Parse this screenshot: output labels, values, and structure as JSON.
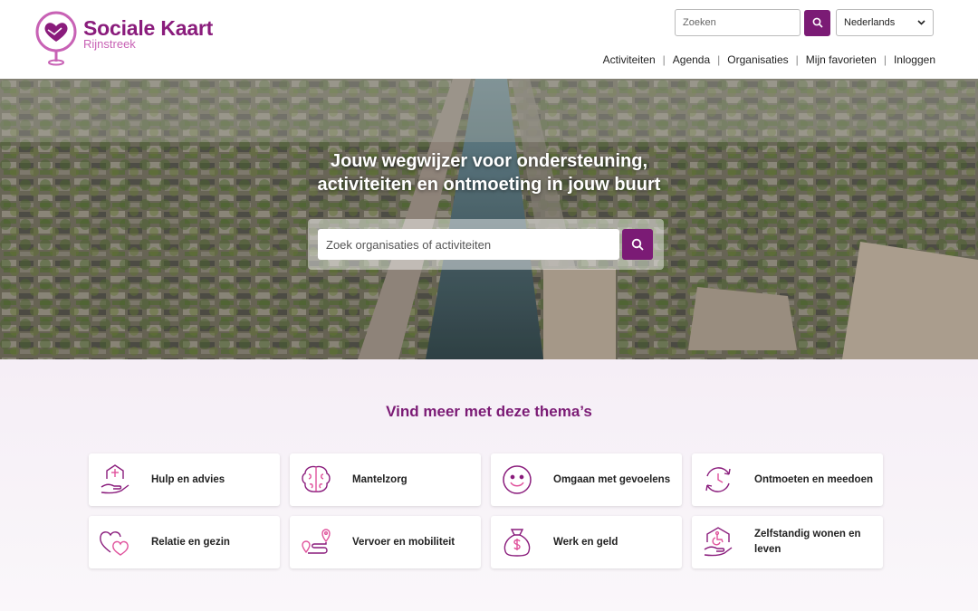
{
  "brand": {
    "title": "Sociale Kaart",
    "subtitle": "Rijnstreek",
    "primary_color": "#7b1b75",
    "accent_color": "#c862b5"
  },
  "header": {
    "search": {
      "placeholder": "Zoeken"
    },
    "language": {
      "selected": "Nederlands"
    },
    "nav": [
      "Activiteiten",
      "Agenda",
      "Organisaties",
      "Mijn favorieten",
      "Inloggen"
    ]
  },
  "hero": {
    "title_line1": "Jouw wegwijzer voor ondersteuning,",
    "title_line2": "activiteiten en ontmoeting in jouw buurt",
    "search_placeholder": "Zoek organisaties of activiteiten"
  },
  "themes": {
    "title": "Vind meer met deze thema’s",
    "items": [
      {
        "label": "Hulp en advies",
        "icon": "hand-house-icon"
      },
      {
        "label": "Mantelzorg",
        "icon": "brain-icon"
      },
      {
        "label": "Omgaan met gevoelens",
        "icon": "smiley-icon"
      },
      {
        "label": "Ontmoeten en meedoen",
        "icon": "clock-cycle-icon"
      },
      {
        "label": "Relatie en gezin",
        "icon": "hearts-icon"
      },
      {
        "label": "Vervoer en mobiliteit",
        "icon": "route-pin-icon"
      },
      {
        "label": "Werk en geld",
        "icon": "money-bag-icon"
      },
      {
        "label": "Zelfstandig wonen en leven",
        "icon": "house-wheelchair-icon"
      }
    ]
  }
}
